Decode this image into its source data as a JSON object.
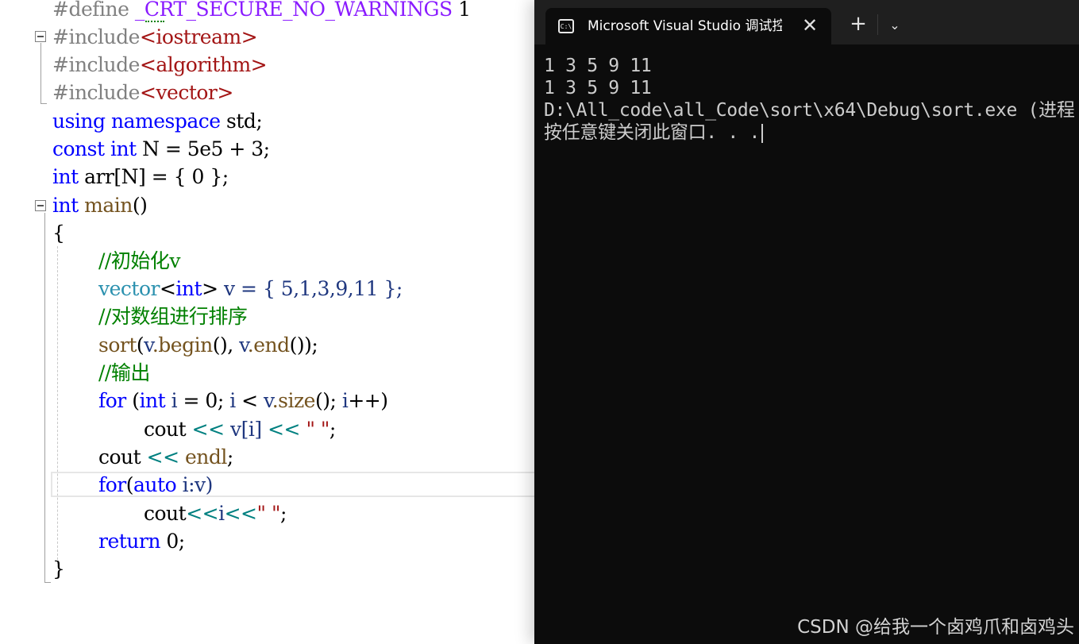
{
  "editor": {
    "define_kw": "#define",
    "define_macro": "_CRT_SECURE_NO_WARNINGS",
    "define_val": "1",
    "include_kw": "#include",
    "hdr_iostream": "<iostream>",
    "hdr_algorithm": "<algorithm>",
    "hdr_vector": "<vector>",
    "kw_using": "using",
    "kw_namespace": "namespace",
    "std_semi": "std;",
    "kw_const": "const",
    "kw_int": "int",
    "const_rest": "N = 5e5 + 3;",
    "arr_name": "arr",
    "arr_rest": "[N] = { 0 };",
    "main_fn": "main",
    "parens": "()",
    "open_brace": "{",
    "comment_init": "//初始化v",
    "vector_type": "vector",
    "lt": "<",
    "gt": ">",
    "v_decl": "v = { 5,1,3,9,11 };",
    "comment_sort": "//对数组进行排序",
    "sort_fn": "sort",
    "sort_open": "(",
    "v_var": "v",
    "begin_fn": ".begin",
    "sort_mid": "(), ",
    "end_fn": ".end",
    "sort_close": "());",
    "comment_out": "//输出",
    "kw_for": "for",
    "for1_open": " (",
    "i_var": "i",
    "for1_a": " = 0; ",
    "for1_b": " < ",
    "size_fn": ".size",
    "for1_c": "(); ",
    "for1_d": "++)",
    "cout1": "cout ",
    "shl": "<<",
    "sp": " ",
    "vi": "v[i]",
    "str_space": "\" \"",
    "semi": ";",
    "cout2": "cout ",
    "endl": "endl",
    "for2_open": "(",
    "kw_auto": "auto",
    "for2_rest": " i:v)",
    "cout3": "cout",
    "i3": "i",
    "kw_return": "return",
    "ret_rest": " 0;",
    "close_brace": "}"
  },
  "terminal": {
    "icon_text": "C:\\",
    "tab_title": "Microsoft Visual Studio 调试控制台",
    "close_glyph": "✕",
    "new_tab_glyph": "+",
    "dropdown_glyph": "⌄",
    "lines": [
      "1 3 5 9 11",
      "1 3 5 9 11",
      "D:\\All_code\\all_Code\\sort\\x64\\Debug\\sort.exe (进程 ",
      "按任意键关闭此窗口. . ."
    ]
  },
  "watermark": "CSDN @给我一个卤鸡爪和卤鸡头"
}
